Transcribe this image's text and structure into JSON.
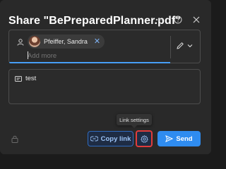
{
  "dialog": {
    "title": "Share \"BePreparedPlanner.pdf\"",
    "more_icon": "more-icon",
    "help_icon": "help-icon",
    "close_icon": "close-icon"
  },
  "recipients": {
    "icon": "person-icon",
    "chips": [
      {
        "name": "Pfeiffer, Sandra",
        "remove_icon": "remove-icon"
      }
    ],
    "input_placeholder": "Add more",
    "permission_icon": "edit-pencil-icon"
  },
  "message": {
    "icon": "message-icon",
    "text": "test"
  },
  "footer": {
    "lock_icon": "lock-icon",
    "copy_link_label": "Copy link",
    "settings_tooltip": "Link settings",
    "send_label": "Send"
  },
  "colors": {
    "accent": "#2f8cf0",
    "focus_underline": "#479ef5",
    "highlight": "#e03c3c",
    "background": "#292929"
  }
}
